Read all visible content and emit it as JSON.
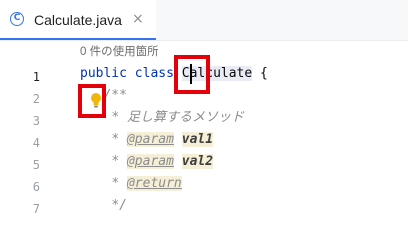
{
  "tab": {
    "icon_letter": "C",
    "filename": "Calculate.java",
    "close": "×"
  },
  "editor": {
    "usages_hint": "0 件の使用箇所",
    "line_numbers": [
      "1",
      "2",
      "3",
      "4",
      "5",
      "6",
      "7"
    ],
    "current_line": 1,
    "lines": {
      "l1": {
        "keyword1": "public",
        "keyword2": "class",
        "class_name": "Calculate",
        "brace": "{"
      },
      "l2": {
        "doc_open": "/**"
      },
      "l3": {
        "doc": "* 足し算するメソッド"
      },
      "l4": {
        "star": "*",
        "tag": "@param",
        "name": "val1"
      },
      "l5": {
        "star": "*",
        "tag": "@param",
        "name": "val2"
      },
      "l6": {
        "star": "*",
        "tag": "@return"
      },
      "l7": {
        "doc_close": "*/"
      }
    }
  },
  "colors": {
    "accent": "#3574f0",
    "keyword": "#0033b3",
    "doc_comment": "#8c8c8c",
    "annotation_box": "#e3000b",
    "lightbulb": "#f2b705"
  }
}
